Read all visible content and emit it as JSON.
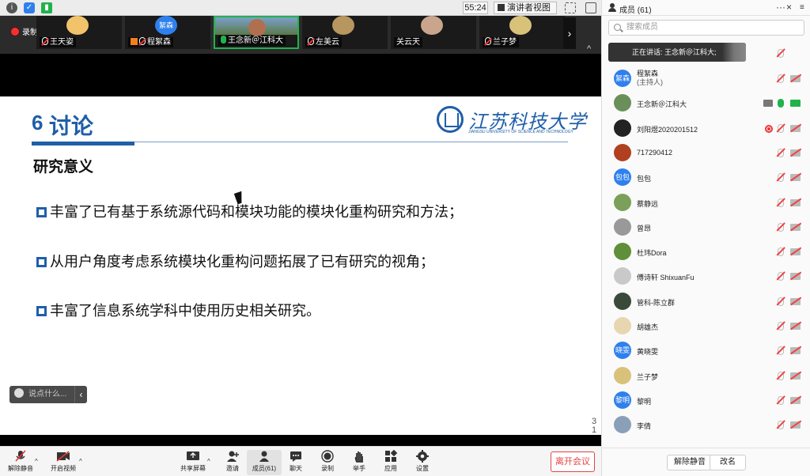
{
  "topbar": {
    "timer": "55:24",
    "view_label": "演讲者视图",
    "view_caret": "▾"
  },
  "strip": {
    "recording_label": "录制中",
    "tiles": [
      {
        "name": "王天姿",
        "avatar_color": "#f2c36b"
      },
      {
        "name": "程絮森",
        "avatar_color": "#2f80ed",
        "avatar_text": "絮森"
      },
      {
        "name": "王念新＠江科大",
        "avatar_color": "#6b8f5a"
      },
      {
        "name": "左美云",
        "avatar_color": "#b89660"
      },
      {
        "name": "关云天",
        "avatar_color": "#c9a58e"
      },
      {
        "name": "兰子梦",
        "avatar_color": "#d8c27a"
      }
    ],
    "next_arrow": "›",
    "collapse_arrow": "^"
  },
  "slide": {
    "section_number": "6",
    "section_title": "讨论",
    "logo_cn": "江苏科技大学",
    "logo_en": "JIANGSU UNIVERSITY OF SCIENCE AND TECHNOLOGY",
    "subtitle": "研究意义",
    "bullets": [
      "丰富了已有基于系统源代码和模块功能的模块化重构研究和方法；",
      "从用户角度考虑系统模块化重构问题拓展了已有研究的视角；",
      "丰富了信息系统学科中使用历史相关研究。"
    ],
    "page_number_top": "3",
    "page_number_bottom": "1"
  },
  "chat_input": {
    "placeholder": "说点什么...",
    "arrow": "‹"
  },
  "toolbar": {
    "unmute": "解除静音",
    "start_video": "开启视频",
    "share": "共享屏幕",
    "invite": "邀请",
    "members": "成员(61)",
    "chat": "聊天",
    "record": "录制",
    "raise_hand": "举手",
    "apps": "应用",
    "settings": "设置",
    "leave": "离开会议"
  },
  "panel": {
    "title": "成员 (61)",
    "more": "···",
    "close": "×",
    "menu": "≡",
    "search_placeholder": "搜索成员",
    "speaking": "正在讲话: 王念新＠江科大;",
    "members": [
      {
        "name": "程絮森",
        "sub": "(主持人)",
        "avatar_text": "絮森",
        "avatar_color": "#2f80ed"
      },
      {
        "name": "王念新＠江科大",
        "avatar_color": "#6b8f5a",
        "mic": "on",
        "cam": "on",
        "sharing": true
      },
      {
        "name": "刘阳煜2020201512",
        "avatar_color": "#222",
        "recording": true
      },
      {
        "name": "717290412",
        "avatar_color": "#b04020"
      },
      {
        "name": "包包",
        "avatar_text": "包包",
        "avatar_color": "#2f80ed"
      },
      {
        "name": "蔡静远",
        "avatar_color": "#7aa05a"
      },
      {
        "name": "曾昂",
        "avatar_color": "#999"
      },
      {
        "name": "杜玮Dora",
        "avatar_color": "#5f8f3a"
      },
      {
        "name": "傅诗轩 ShixuanFu",
        "avatar_color": "#c9c9c9"
      },
      {
        "name": "管科-陈立群",
        "avatar_color": "#3a4a3a"
      },
      {
        "name": "胡雄杰",
        "avatar_color": "#e8d6b0"
      },
      {
        "name": "黄晓雯",
        "avatar_text": "晓雯",
        "avatar_color": "#2f80ed"
      },
      {
        "name": "兰子梦",
        "avatar_color": "#d8c27a"
      },
      {
        "name": "黎明",
        "avatar_text": "黎明",
        "avatar_color": "#2f80ed"
      },
      {
        "name": "李倩",
        "avatar_color": "#8aa0b8"
      }
    ],
    "unmute_all": "解除静音",
    "rename": "改名"
  }
}
